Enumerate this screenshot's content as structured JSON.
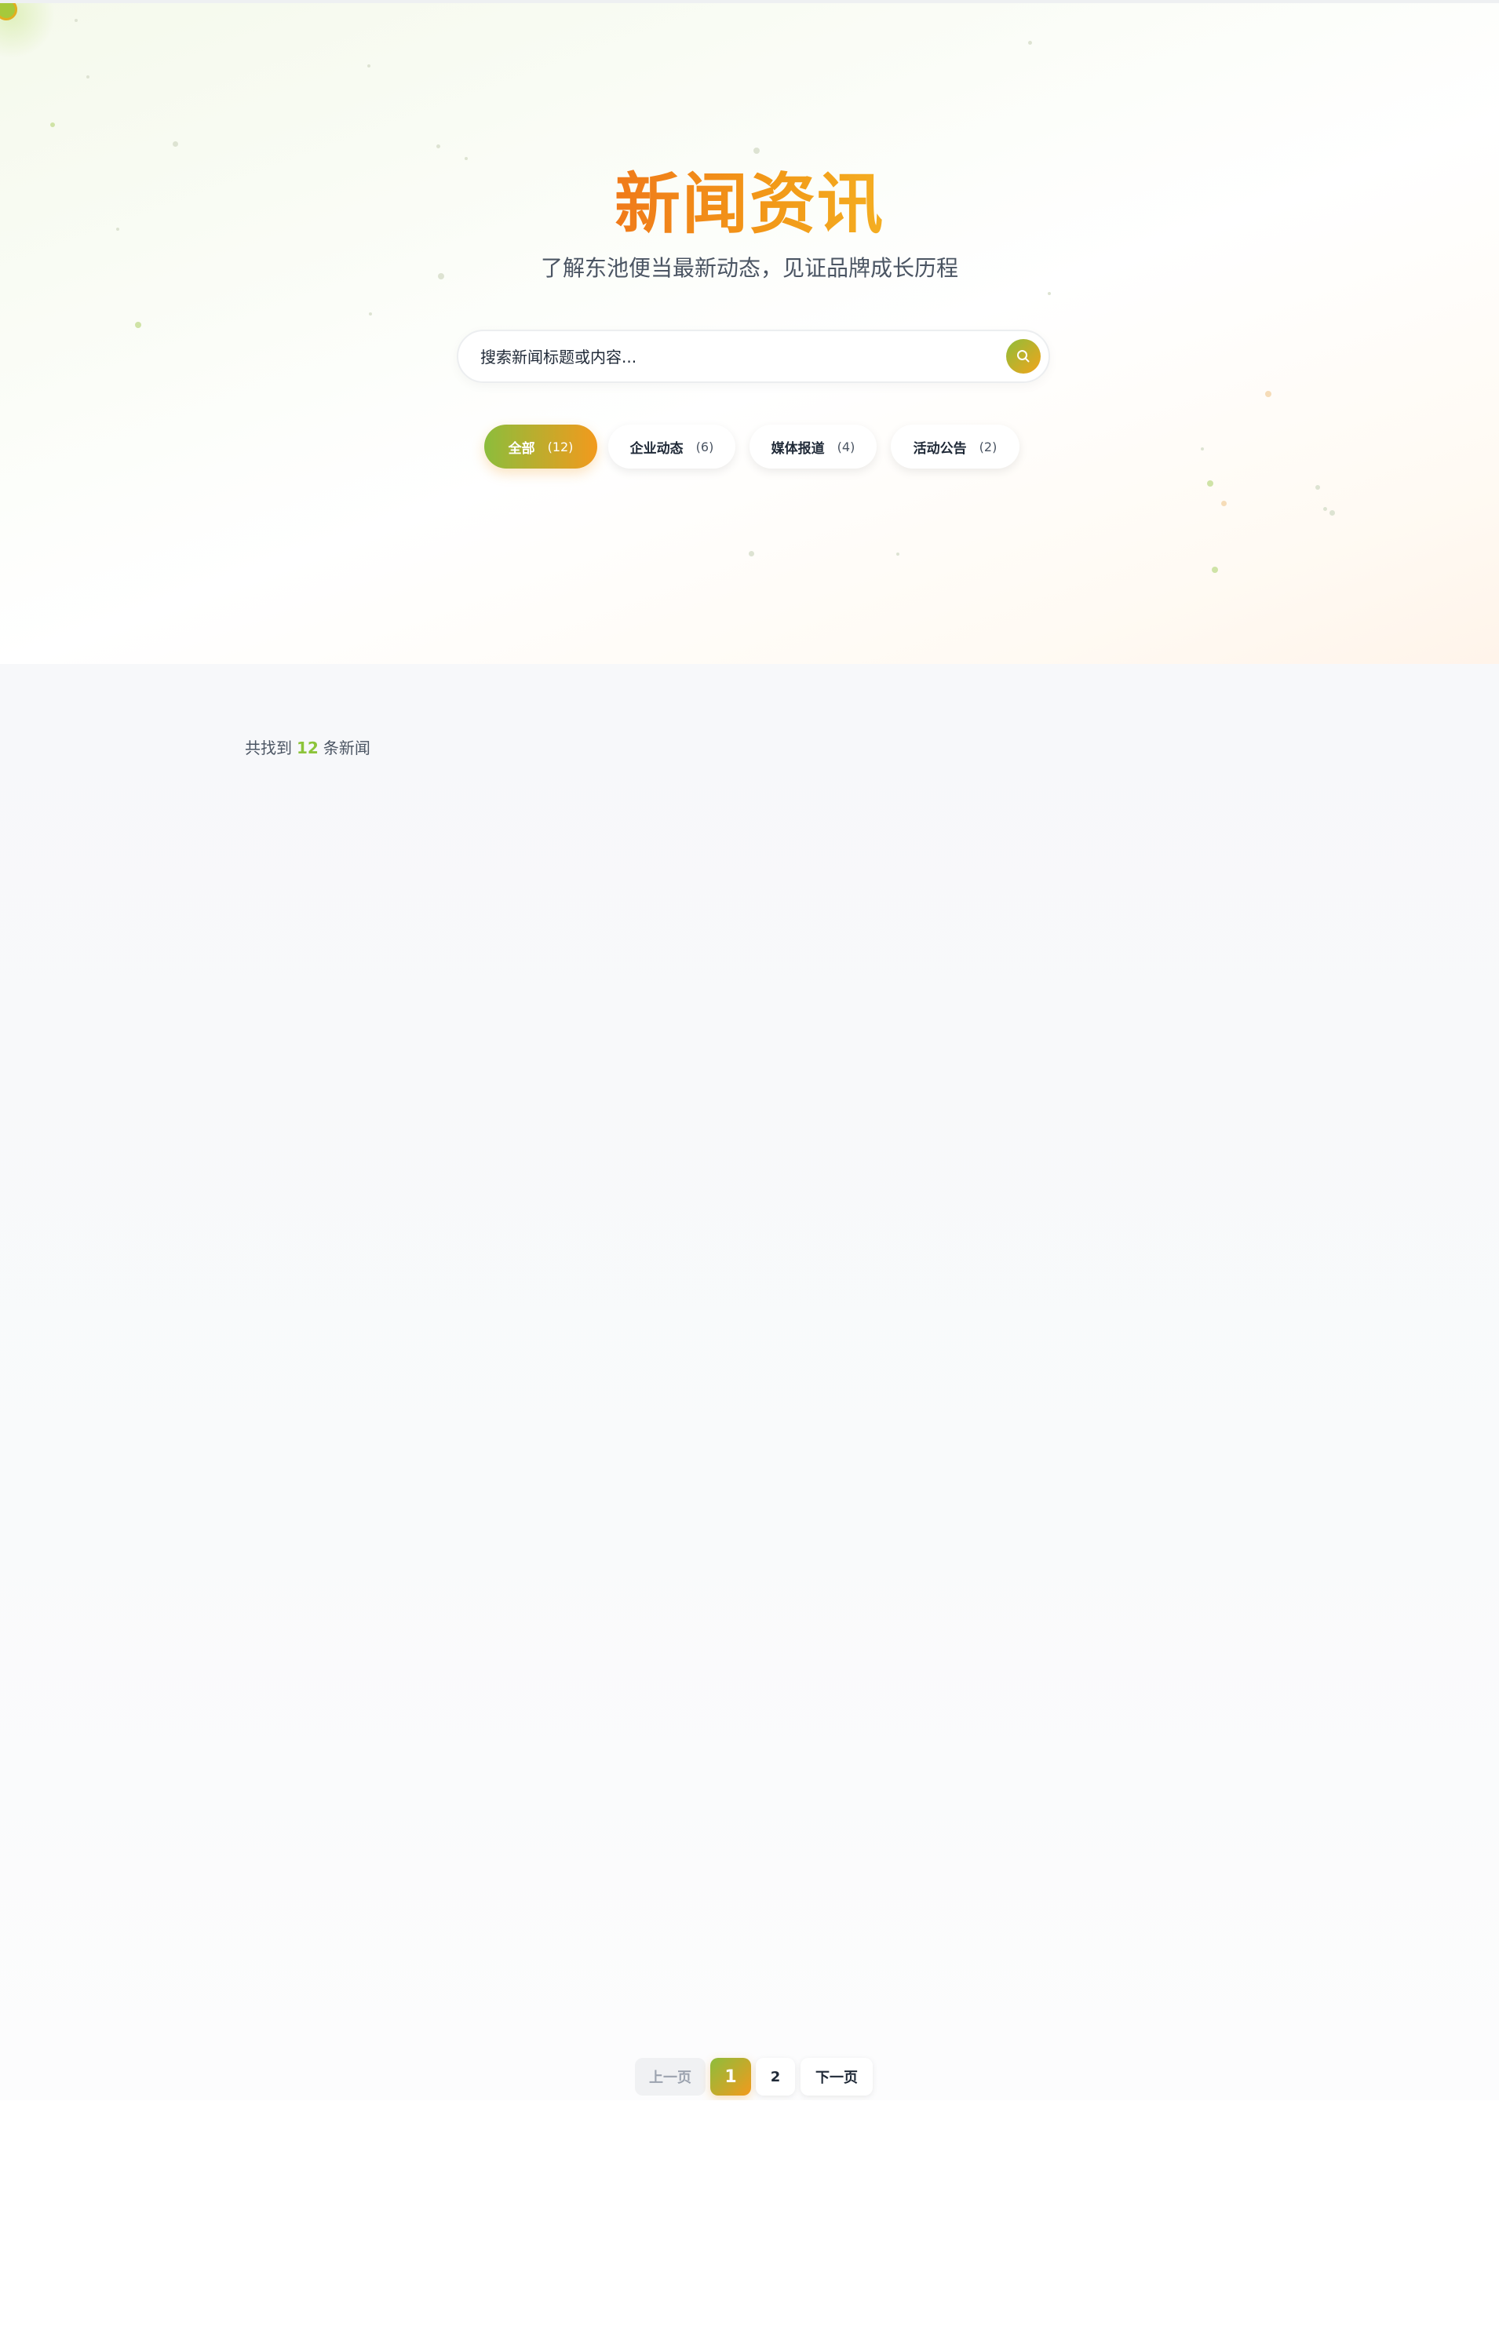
{
  "hero": {
    "title": "新闻资讯",
    "subtitle": "了解东池便当最新动态，见证品牌成长历程"
  },
  "search": {
    "placeholder": "搜索新闻标题或内容...",
    "value": "",
    "button_icon": "search-icon"
  },
  "filters": [
    {
      "label": "全部",
      "count": "(12)",
      "active": true
    },
    {
      "label": "企业动态",
      "count": "(6)",
      "active": false
    },
    {
      "label": "媒体报道",
      "count": "(4)",
      "active": false
    },
    {
      "label": "活动公告",
      "count": "(2)",
      "active": false
    }
  ],
  "results": {
    "prefix": "共找到",
    "count": "12",
    "suffix": "条新闻"
  },
  "pagination": {
    "prev_label": "上一页",
    "pages": [
      "1",
      "2"
    ],
    "current_page": "1",
    "next_label": "下一页"
  },
  "colors": {
    "accent_green": "#8cbd3c",
    "accent_orange": "#f29a1d",
    "title_orange": "#f08a1e",
    "text_dark": "#1f2937",
    "text_muted": "#4b5563"
  }
}
